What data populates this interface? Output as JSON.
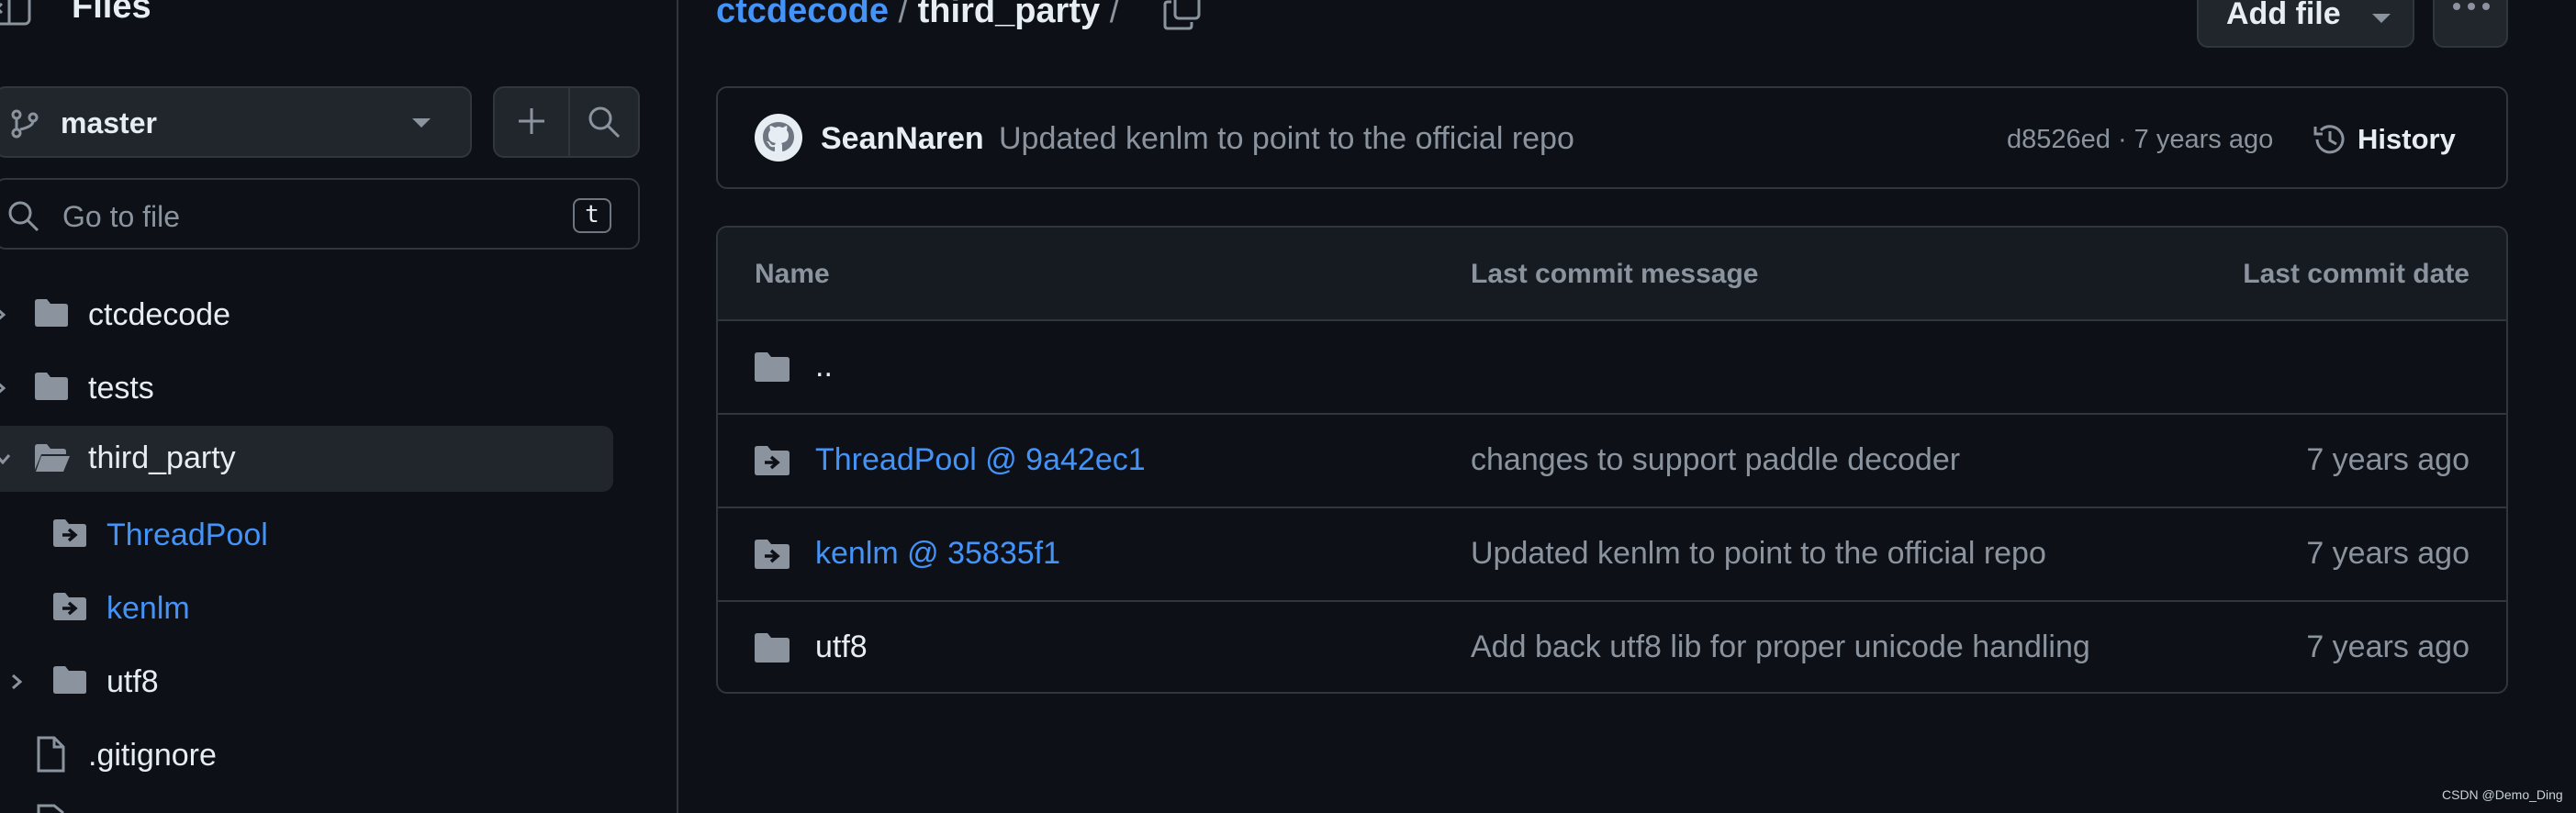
{
  "sidebar": {
    "title": "Files",
    "branch": "master",
    "goto_placeholder": "Go to file",
    "goto_shortcut": "t",
    "tree": [
      {
        "label": "ctcdecode",
        "type": "folder"
      },
      {
        "label": "tests",
        "type": "folder"
      },
      {
        "label": "third_party",
        "type": "folder-open",
        "selected": true
      },
      {
        "label": "ThreadPool",
        "type": "submodule"
      },
      {
        "label": "kenlm",
        "type": "submodule"
      },
      {
        "label": "utf8",
        "type": "folder"
      },
      {
        "label": ".gitignore",
        "type": "file"
      }
    ]
  },
  "breadcrumb": {
    "repo": "ctcdecode",
    "separator": "/",
    "current": "third_party",
    "trailing": "/"
  },
  "toolbar": {
    "add_file_label": "Add file"
  },
  "commit": {
    "author": "SeanNaren",
    "message": "Updated kenlm to point to the official repo",
    "meta": "d8526ed · 7 years ago",
    "history_label": "History"
  },
  "table": {
    "headers": {
      "name": "Name",
      "message": "Last commit message",
      "date": "Last commit date"
    },
    "parent_label": "..",
    "rows": [
      {
        "name": "ThreadPool @ 9a42ec1",
        "type": "submodule",
        "message": "changes to support paddle decoder",
        "date": "7 years ago"
      },
      {
        "name": "kenlm @ 35835f1",
        "type": "submodule",
        "message": "Updated kenlm to point to the official repo",
        "date": "7 years ago"
      },
      {
        "name": "utf8",
        "type": "folder",
        "message": "Add back utf8 lib for proper unicode handling",
        "date": "7 years ago"
      }
    ]
  },
  "watermark": "CSDN @Demo_Ding",
  "colors": {
    "background": "#0d1117",
    "border": "#30363d",
    "link": "#4493f8",
    "muted": "#8b949e",
    "text": "#e6edf3",
    "icon": "#8b949e"
  }
}
